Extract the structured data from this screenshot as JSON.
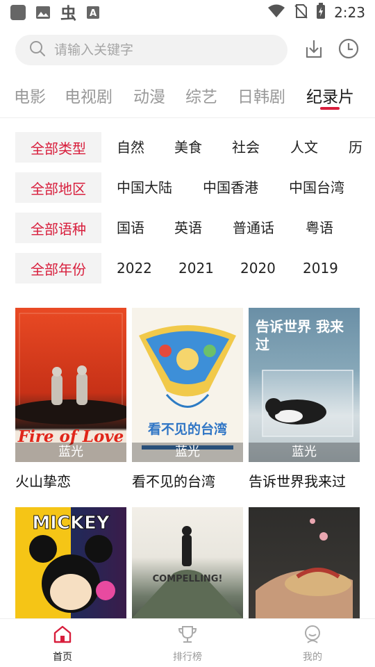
{
  "status_bar": {
    "time": "2:23"
  },
  "search": {
    "placeholder": "请输入关键字"
  },
  "tabs": [
    {
      "label": "电影"
    },
    {
      "label": "电视剧"
    },
    {
      "label": "动漫"
    },
    {
      "label": "综艺"
    },
    {
      "label": "日韩剧"
    },
    {
      "label": "纪录片"
    }
  ],
  "active_tab": "纪录片",
  "filters": {
    "type": {
      "selected": "全部类型",
      "options": [
        "自然",
        "美食",
        "社会",
        "人文",
        "历"
      ]
    },
    "region": {
      "selected": "全部地区",
      "options": [
        "中国大陆",
        "中国香港",
        "中国台湾"
      ]
    },
    "language": {
      "selected": "全部语种",
      "options": [
        "国语",
        "英语",
        "普通话",
        "粤语"
      ]
    },
    "year": {
      "selected": "全部年份",
      "options": [
        "2022",
        "2021",
        "2020",
        "2019"
      ]
    }
  },
  "cards": [
    {
      "title": "火山挚恋",
      "badge": "蓝光",
      "poster_text": "Fire of Love"
    },
    {
      "title": "看不见的台湾",
      "badge": "蓝光",
      "poster_text": "看不见的台湾"
    },
    {
      "title": "告诉世界我来过",
      "badge": "蓝光",
      "poster_text": "告诉世界 我来过"
    },
    {
      "title": "",
      "badge": "",
      "poster_text": "MICKEY"
    },
    {
      "title": "",
      "badge": "",
      "poster_text": "COMPELLING!"
    },
    {
      "title": "",
      "badge": "",
      "poster_text": ""
    }
  ],
  "bottom_nav": [
    {
      "label": "首页"
    },
    {
      "label": "排行榜"
    },
    {
      "label": "我的"
    }
  ],
  "colors": {
    "accent": "#d81e3c",
    "inactive": "#999999"
  }
}
